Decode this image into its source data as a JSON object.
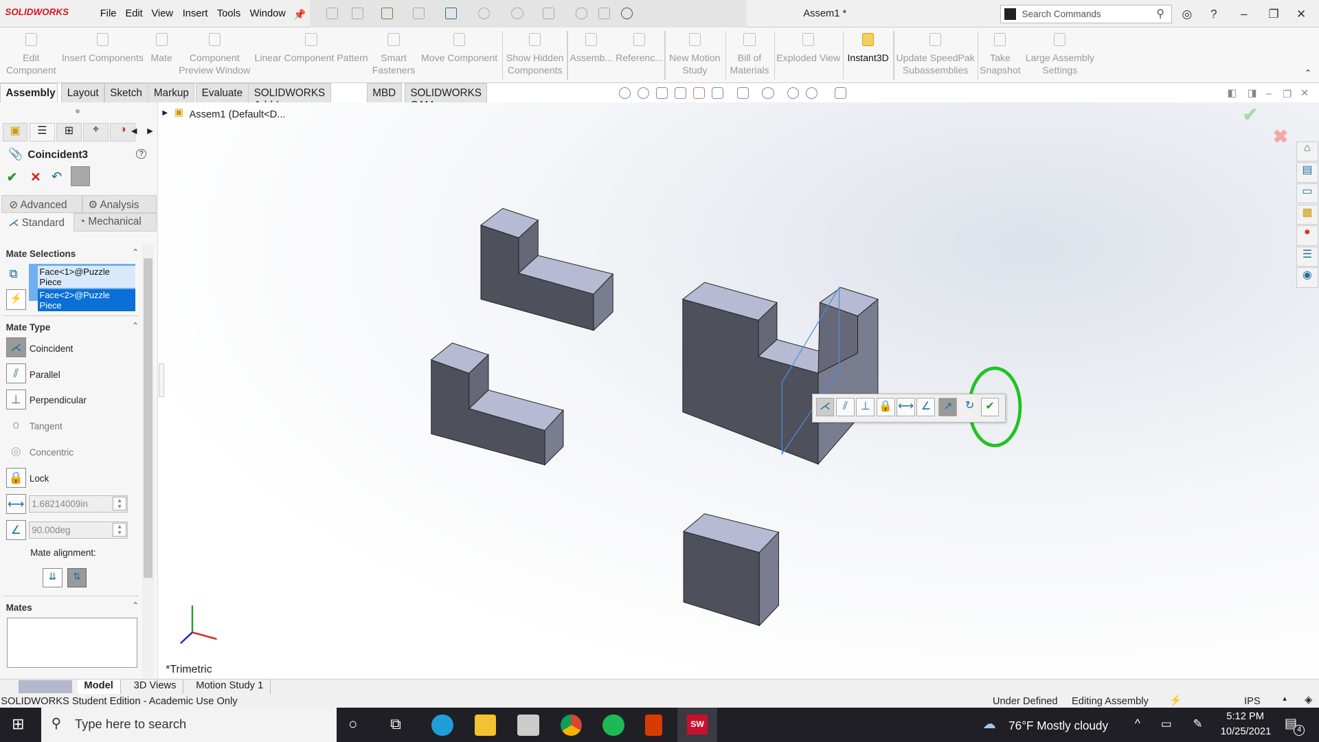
{
  "app": {
    "brand": "SOLIDWORKS",
    "document_title": "Assem1 *",
    "search_placeholder": "Search Commands"
  },
  "menu": [
    "File",
    "Edit",
    "View",
    "Insert",
    "Tools",
    "Window"
  ],
  "ribbon": [
    {
      "label": "Edit Component",
      "enabled": false
    },
    {
      "label": "Insert Components",
      "enabled": false
    },
    {
      "label": "Mate",
      "enabled": false
    },
    {
      "label": "Component Preview Window",
      "enabled": false
    },
    {
      "label": "Linear Component Pattern",
      "enabled": false
    },
    {
      "label": "Smart Fasteners",
      "enabled": false
    },
    {
      "label": "Move Component",
      "enabled": false
    },
    {
      "label": "Show Hidden Components",
      "enabled": false
    },
    {
      "label": "Assemb...",
      "enabled": false
    },
    {
      "label": "Referenc...",
      "enabled": false
    },
    {
      "label": "New Motion Study",
      "enabled": false
    },
    {
      "label": "Bill of Materials",
      "enabled": false
    },
    {
      "label": "Exploded View",
      "enabled": false
    },
    {
      "label": "Instant3D",
      "enabled": true
    },
    {
      "label": "Update SpeedPak Subassemblies",
      "enabled": false
    },
    {
      "label": "Take Snapshot",
      "enabled": false
    },
    {
      "label": "Large Assembly Settings",
      "enabled": false
    }
  ],
  "tabs": [
    "Assembly",
    "Layout",
    "Sketch",
    "Markup",
    "Evaluate",
    "SOLIDWORKS Add-Ins",
    "MBD",
    "SOLIDWORKS CAM"
  ],
  "panel": {
    "title": "Coincident3",
    "tabs_top": [
      "Advanced",
      "Analysis"
    ],
    "tabs_bottom": [
      "Standard",
      "Mechanical"
    ],
    "mate_selections_label": "Mate Selections",
    "selections": [
      "Face<1>@Puzzle Piece",
      "Face<2>@Puzzle Piece"
    ],
    "mate_type_label": "Mate Type",
    "mate_types": [
      "Coincident",
      "Parallel",
      "Perpendicular",
      "Tangent",
      "Concentric",
      "Lock"
    ],
    "distance_value": "1.68214009in",
    "angle_value": "90.00deg",
    "alignment_label": "Mate alignment:",
    "mates_label": "Mates"
  },
  "viewport": {
    "tree_root": "Assem1  (Default<D...",
    "view_label": "*Trimetric",
    "accent": "#22c322"
  },
  "bottom_tabs": [
    "Model",
    "3D Views",
    "Motion Study 1"
  ],
  "status": {
    "left": "SOLIDWORKS Student Edition - Academic Use Only",
    "state": "Under Defined",
    "mode": "Editing Assembly",
    "units": "IPS"
  },
  "taskbar": {
    "search": "Type here to search",
    "weather": "76°F  Mostly cloudy",
    "time": "5:12 PM",
    "date": "10/25/2021",
    "notifications": "4"
  }
}
